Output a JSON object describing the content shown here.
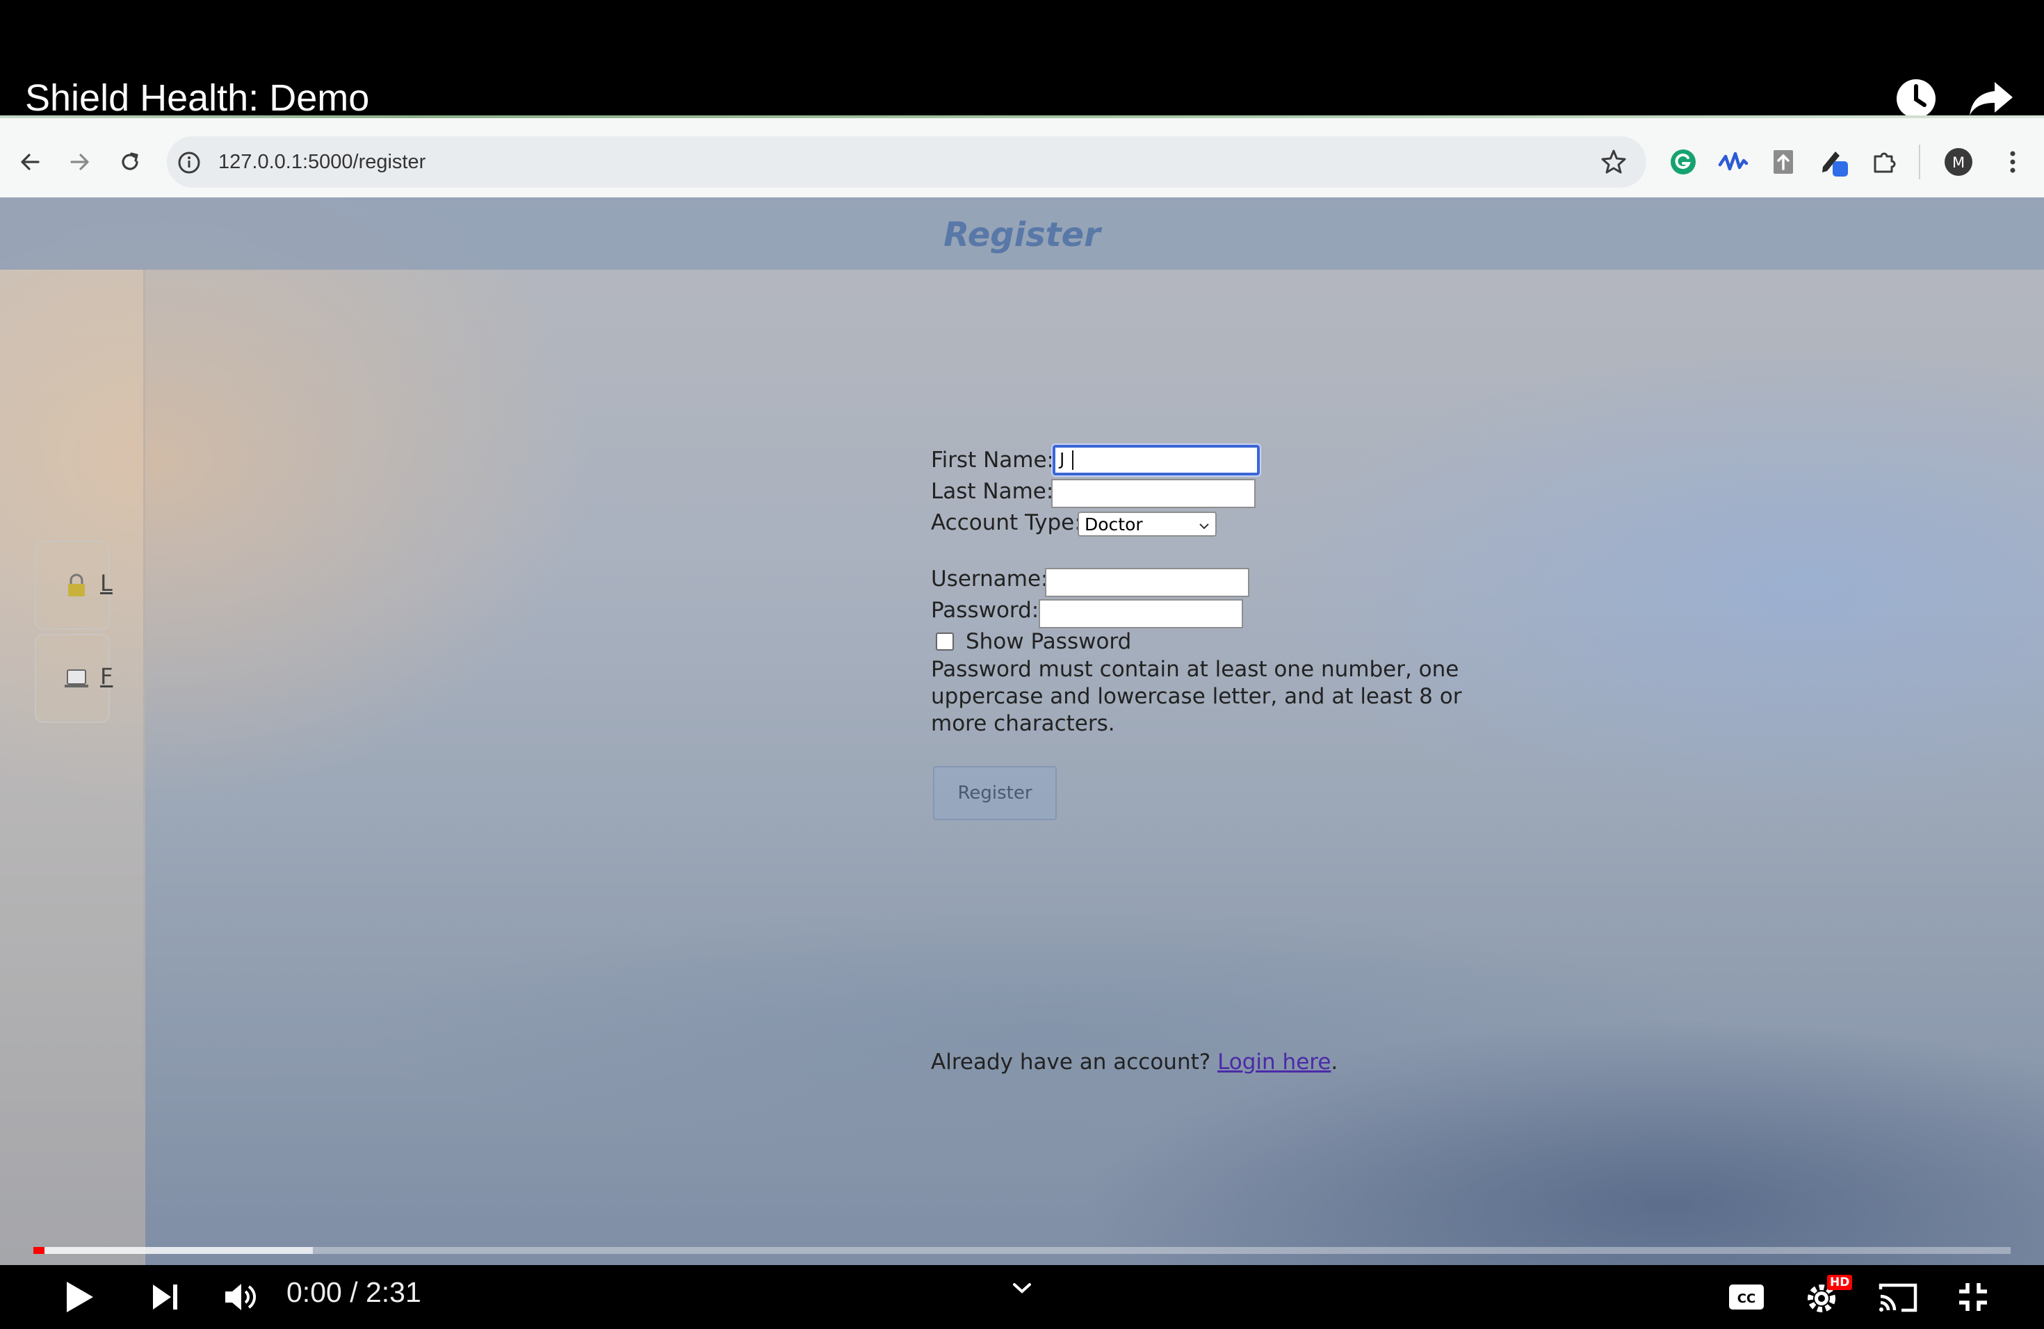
{
  "video": {
    "title": "Shield Health: Demo",
    "time_current": "0:00",
    "time_total": "2:31",
    "time_display": "0:00 / 2:31",
    "progress_played": 0.0,
    "progress_buffered": 0.14,
    "hd_badge": "HD",
    "icons": [
      "watch-later-icon",
      "share-icon",
      "play-icon",
      "next-icon",
      "volume-icon",
      "chevron-down-icon",
      "captions-icon",
      "settings-icon",
      "cast-icon",
      "exit-fullscreen-icon"
    ]
  },
  "browser": {
    "url": "127.0.0.1:5000/register",
    "profile_initial": "M",
    "icons": [
      "back-icon",
      "forward-icon",
      "reload-icon",
      "site-info-icon",
      "bookmark-star-icon",
      "grammarly-icon",
      "extension-wave-icon",
      "extension-upload-icon",
      "extension-pen-icon",
      "extensions-puzzle-icon",
      "profile-avatar",
      "kebab-menu-icon"
    ]
  },
  "page": {
    "heading": "Register",
    "sidebar": {
      "items": [
        {
          "icon": "lock-icon",
          "label": "L"
        },
        {
          "icon": "laptop-icon",
          "label": "F"
        }
      ]
    },
    "form": {
      "first_name_label": "First Name:",
      "first_name_value": "J",
      "last_name_label": "Last Name:",
      "last_name_value": "",
      "account_type_label": "Account Type:",
      "account_type_value": "Doctor",
      "username_label": "Username:",
      "username_value": "",
      "password_label": "Password:",
      "password_value": "",
      "show_password_label": "Show Password",
      "show_password_checked": false,
      "password_help": "Password must contain at least one number, one uppercase and lowercase letter, and at least 8 or more characters.",
      "register_button": "Register"
    },
    "login_prompt": "Already have an account?",
    "login_link": "Login here",
    "login_suffix": "."
  }
}
